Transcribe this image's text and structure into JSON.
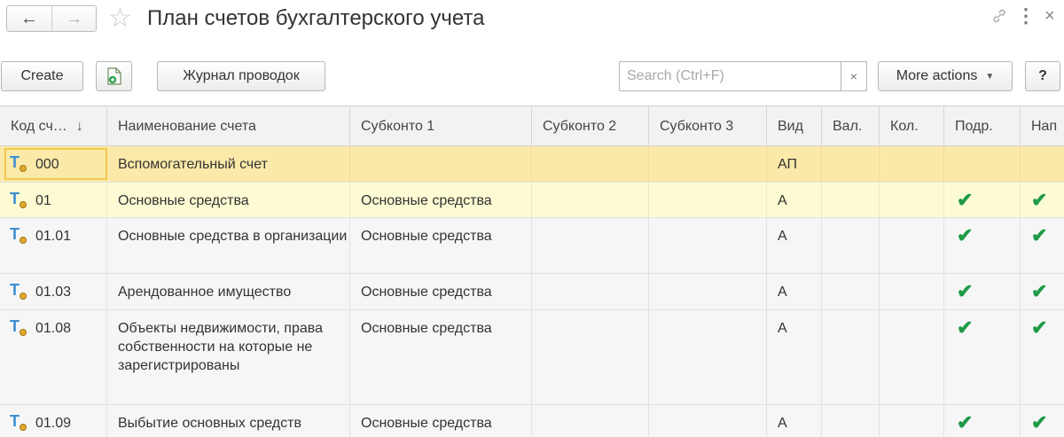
{
  "window": {
    "title": "План счетов бухгалтерского учета",
    "back_glyph": "←",
    "forward_glyph": "→",
    "star_glyph": "☆",
    "link_glyph": "🔗",
    "more_glyph": "⋮",
    "close_glyph": "×"
  },
  "toolbar": {
    "create_label": "Create",
    "journal_label": "Журнал проводок",
    "search_placeholder": "Search (Ctrl+F)",
    "clear_glyph": "×",
    "more_actions_label": "More actions",
    "more_caret": "▼",
    "help_label": "?"
  },
  "table": {
    "columns": [
      "Код сч…",
      "Наименование счета",
      "Субконто 1",
      "Субконто 2",
      "Субконто 3",
      "Вид",
      "Вал.",
      "Кол.",
      "Подр.",
      "Нап"
    ],
    "sort_glyph": "↓",
    "check_glyph": "✔",
    "type_glyph": "T",
    "rows": [
      {
        "code": "000",
        "name": "Вспомогательный счет",
        "s1": "",
        "s2": "",
        "s3": "",
        "vid": "АП",
        "val": "",
        "kol": "",
        "podr": "",
        "nap": ""
      },
      {
        "code": "01",
        "name": "Основные средства",
        "s1": "Основные средства",
        "s2": "",
        "s3": "",
        "vid": "А",
        "val": "",
        "kol": "",
        "podr": "✔",
        "nap": "✔"
      },
      {
        "code": "01.01",
        "name": "Основные средства в организации",
        "s1": "Основные средства",
        "s2": "",
        "s3": "",
        "vid": "А",
        "val": "",
        "kol": "",
        "podr": "✔",
        "nap": "✔"
      },
      {
        "code": "01.03",
        "name": "Арендованное имущество",
        "s1": "Основные средства",
        "s2": "",
        "s3": "",
        "vid": "А",
        "val": "",
        "kol": "",
        "podr": "✔",
        "nap": "✔"
      },
      {
        "code": "01.08",
        "name": "Объекты недвижимости, права собственности на которые не зарегистрированы",
        "s1": "Основные средства",
        "s2": "",
        "s3": "",
        "vid": "А",
        "val": "",
        "kol": "",
        "podr": "✔",
        "nap": "✔"
      },
      {
        "code": "01.09",
        "name": "Выбытие основных средств",
        "s1": "Основные средства",
        "s2": "",
        "s3": "",
        "vid": "А",
        "val": "",
        "kol": "",
        "podr": "✔",
        "nap": "✔"
      }
    ]
  },
  "colors": {
    "selected_row": "#fbe9a9",
    "current_row": "#fdfbd3",
    "check": "#1f9a46",
    "type_icon": "#3d8fd1"
  }
}
